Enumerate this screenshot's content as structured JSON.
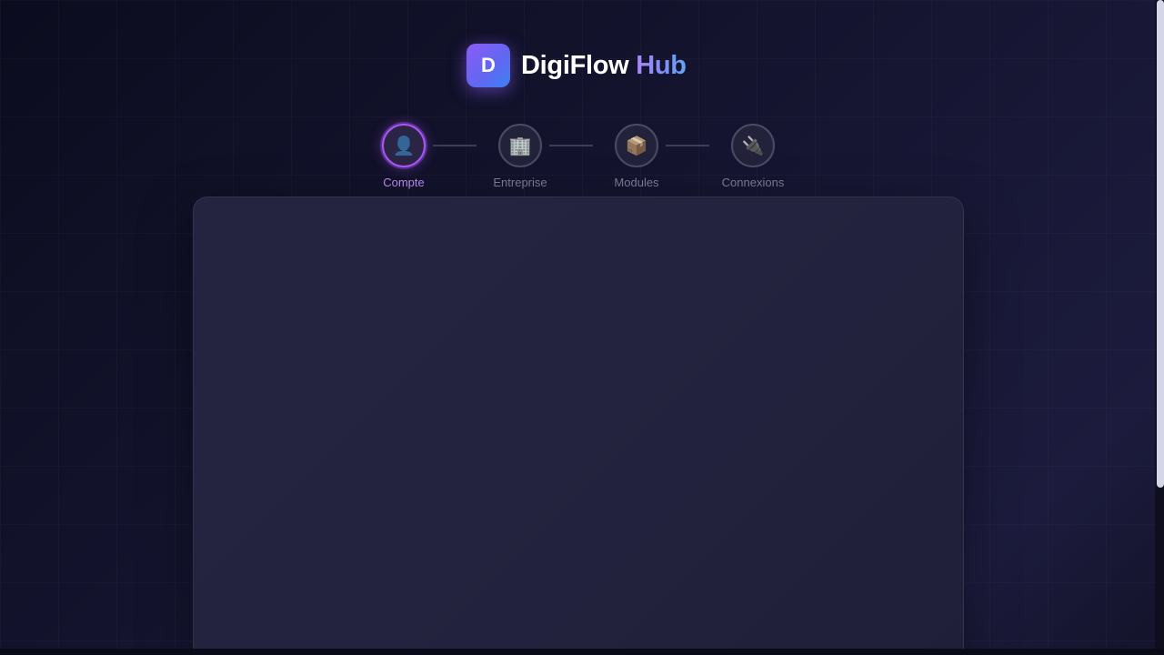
{
  "brand": {
    "logo_letter": "D",
    "name": "DigiFlow",
    "name_accent": "Hub"
  },
  "stepper": {
    "steps": [
      {
        "label": "Compte",
        "icon": "user-icon",
        "glyph": "👤",
        "active": true
      },
      {
        "label": "Entreprise",
        "icon": "building-icon",
        "glyph": "🏢",
        "active": false
      },
      {
        "label": "Modules",
        "icon": "package-icon",
        "glyph": "📦",
        "active": false
      },
      {
        "label": "Connexions",
        "icon": "plug-icon",
        "glyph": "🔌",
        "active": false
      }
    ]
  },
  "colors": {
    "accent": "#a855f7",
    "background": "#14142f",
    "card": "#23233f"
  }
}
